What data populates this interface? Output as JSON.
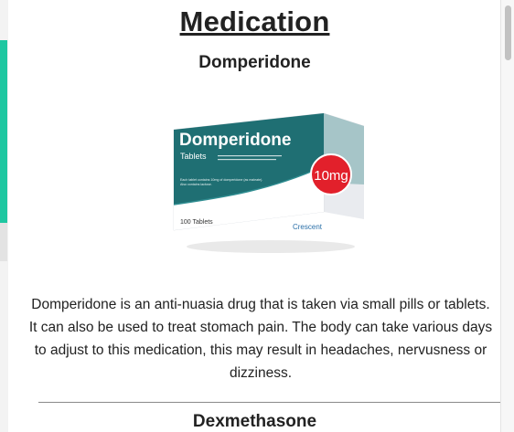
{
  "page": {
    "title": "Medication"
  },
  "medications": [
    {
      "name": "Domperidone",
      "image": {
        "brand": "Domperidone",
        "form": "Tablets",
        "dose": "10mg",
        "fine_print_1": "Each tablet contains 10mg of domperidone (as maleate).",
        "fine_print_2": "Also contains lactose.",
        "count": "100 Tablets",
        "maker": "Crescent"
      },
      "description": "Domperidone is an anti-nuasia drug that is taken via small pills or tablets. It can also be used to treat stomach pain. The body can take various days to adjust to this medication, this may result in headaches, nervusness or dizziness."
    },
    {
      "name": "Dexmethasone"
    }
  ],
  "colors": {
    "accent": "#1ec7a1",
    "box_teal": "#1f6f73",
    "dose_red": "#e2202b"
  }
}
